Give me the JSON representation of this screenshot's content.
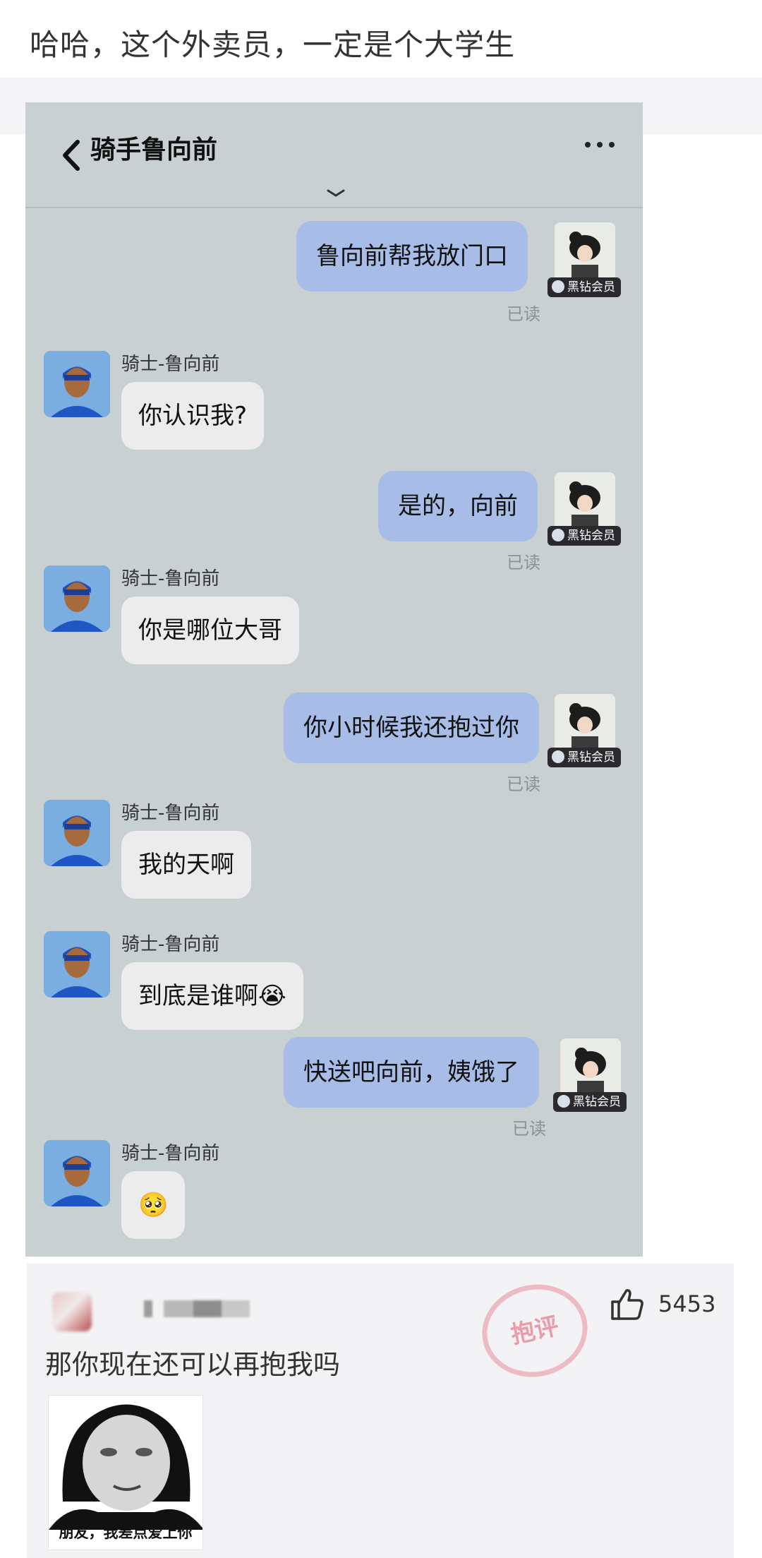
{
  "post": {
    "title": "哈哈，这个外卖员，一定是个大学生"
  },
  "chat": {
    "header_title": "骑手鲁向前",
    "vip_label": "黑钻会员",
    "read_label": "已读",
    "sender_name": "骑士-鲁向前",
    "messages": [
      {
        "side": "out",
        "text": "鲁向前帮我放门口"
      },
      {
        "side": "in",
        "text": "你认识我?"
      },
      {
        "side": "out",
        "text": "是的，向前"
      },
      {
        "side": "in",
        "text": "你是哪位大哥"
      },
      {
        "side": "out",
        "text": "你小时候我还抱过你"
      },
      {
        "side": "in",
        "text": "我的天啊"
      },
      {
        "side": "in",
        "text": "到底是谁啊😭"
      },
      {
        "side": "out",
        "text": "快送吧向前，姨饿了"
      },
      {
        "side": "in",
        "text": "🥺"
      }
    ]
  },
  "comment": {
    "stamp_text": "抱评",
    "like_count": "5453",
    "text": "那你现在还可以再抱我吗",
    "meme_caption": "朋友，我差点爱上你"
  }
}
